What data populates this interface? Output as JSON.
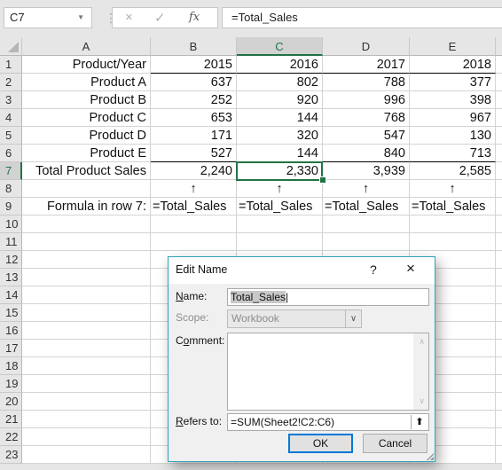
{
  "formula_bar": {
    "name_box": "C7",
    "cancel_icon": "×",
    "enter_icon": "✓",
    "fx_icon": "fx",
    "formula": "=Total_Sales"
  },
  "columns": [
    "A",
    "B",
    "C",
    "D",
    "E"
  ],
  "selected_column": "C",
  "selected_row": "7",
  "rows": [
    {
      "num": "1",
      "cells": [
        "Product/Year",
        "2015",
        "2016",
        "2017",
        "2018"
      ]
    },
    {
      "num": "2",
      "cells": [
        "Product A",
        "637",
        "802",
        "788",
        "377"
      ]
    },
    {
      "num": "3",
      "cells": [
        "Product B",
        "252",
        "920",
        "996",
        "398"
      ]
    },
    {
      "num": "4",
      "cells": [
        "Product C",
        "653",
        "144",
        "768",
        "967"
      ]
    },
    {
      "num": "5",
      "cells": [
        "Product D",
        "171",
        "320",
        "547",
        "130"
      ]
    },
    {
      "num": "6",
      "cells": [
        "Product E",
        "527",
        "144",
        "840",
        "713"
      ]
    },
    {
      "num": "7",
      "cells": [
        "Total Product Sales",
        "2,240",
        "2,330",
        "3,939",
        "2,585"
      ]
    },
    {
      "num": "8",
      "cells": [
        "",
        "↑",
        "↑",
        "↑",
        "↑"
      ]
    },
    {
      "num": "9",
      "cells": [
        "Formula in row 7:",
        "=Total_Sales",
        "=Total_Sales",
        "=Total_Sales",
        "=Total_Sales"
      ]
    },
    {
      "num": "10",
      "cells": [
        "",
        "",
        "",
        "",
        ""
      ]
    },
    {
      "num": "11",
      "cells": [
        "",
        "",
        "",
        "",
        ""
      ]
    },
    {
      "num": "12",
      "cells": [
        "",
        "",
        "",
        "",
        ""
      ]
    },
    {
      "num": "13",
      "cells": [
        "",
        "",
        "",
        "",
        ""
      ]
    },
    {
      "num": "14",
      "cells": [
        "",
        "",
        "",
        "",
        ""
      ]
    },
    {
      "num": "15",
      "cells": [
        "",
        "",
        "",
        "",
        ""
      ]
    },
    {
      "num": "16",
      "cells": [
        "",
        "",
        "",
        "",
        ""
      ]
    },
    {
      "num": "17",
      "cells": [
        "",
        "",
        "",
        "",
        ""
      ]
    },
    {
      "num": "18",
      "cells": [
        "",
        "",
        "",
        "",
        ""
      ]
    },
    {
      "num": "19",
      "cells": [
        "",
        "",
        "",
        "",
        ""
      ]
    },
    {
      "num": "20",
      "cells": [
        "",
        "",
        "",
        "",
        ""
      ]
    },
    {
      "num": "21",
      "cells": [
        "",
        "",
        "",
        "",
        ""
      ]
    },
    {
      "num": "22",
      "cells": [
        "",
        "",
        "",
        "",
        ""
      ]
    },
    {
      "num": "23",
      "cells": [
        "",
        "",
        "",
        "",
        ""
      ]
    }
  ],
  "dialog": {
    "title": "Edit Name",
    "help": "?",
    "close": "×",
    "name_label_u": "N",
    "name_label_rest": "ame:",
    "name_value": "Total_Sales",
    "scope_label": "Scope:",
    "scope_value": "Workbook",
    "comment_label_pre": "C",
    "comment_label_u": "o",
    "comment_label_rest": "mment:",
    "comment_value": "",
    "refers_label_u": "R",
    "refers_label_rest": "efers to:",
    "refers_value": "=SUM(Sheet2!C2:C6)",
    "ok": "OK",
    "cancel": "Cancel"
  }
}
